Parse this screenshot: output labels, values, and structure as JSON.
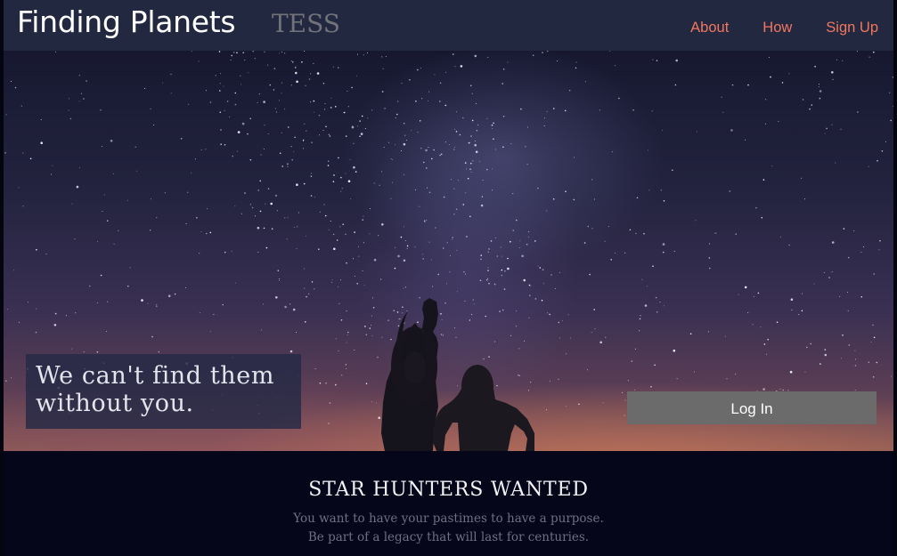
{
  "navbar": {
    "brand": "Finding Planets",
    "subtitle": "TESS",
    "links": [
      "About",
      "How",
      "Sign Up"
    ]
  },
  "hero": {
    "tagline_line1": "We can't find them",
    "tagline_line2": "without you.",
    "login_label": "Log In"
  },
  "section": {
    "title": "STAR HUNTERS WANTED",
    "line1": "You want to have your pastimes to have a purpose.",
    "line2": "Be part of a legacy that will last for centuries."
  },
  "colors": {
    "navbar_bg": "#22283f",
    "nav_link": "#f0765f",
    "login_button": "#6b6b6b",
    "section_bg": "#06061a"
  }
}
